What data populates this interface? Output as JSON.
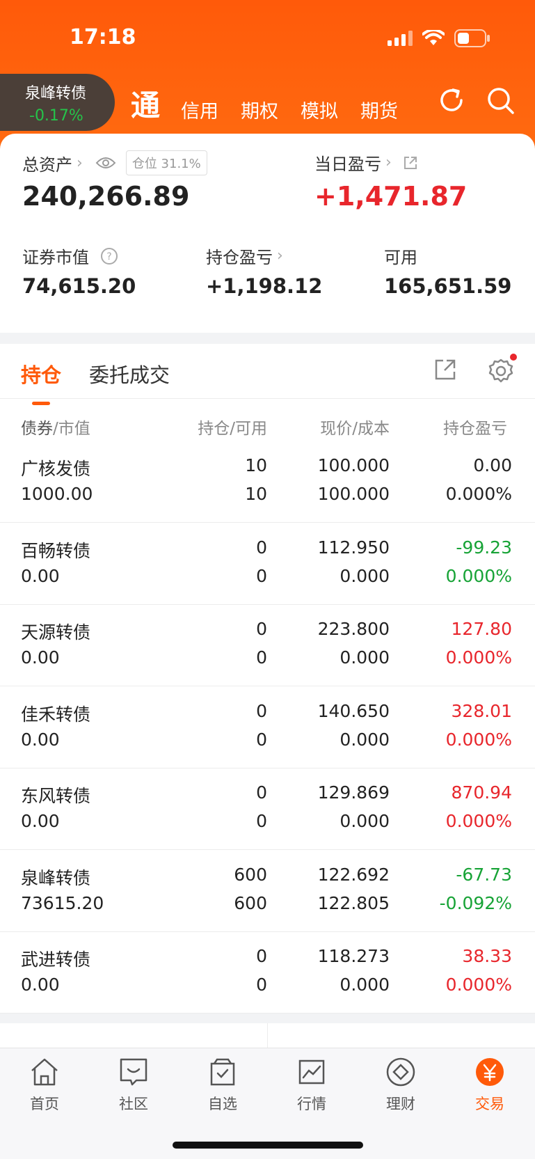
{
  "status_bar": {
    "time": "17:18"
  },
  "floating_ticker": {
    "name": "泉峰转债",
    "change_pct": "-0.17%"
  },
  "nav": {
    "main_tab": "通",
    "tabs": [
      "信用",
      "期权",
      "模拟",
      "期货"
    ],
    "icons": [
      "refresh-icon",
      "search-icon"
    ]
  },
  "summary": {
    "total_assets_label": "总资产",
    "position_ratio": "仓位 31.1%",
    "total_assets_value": "240,266.89",
    "daily_pnl_label": "当日盈亏",
    "daily_pnl_value": "+1,471.87",
    "market_value_label": "证券市值",
    "market_value": "74,615.20",
    "holding_pnl_label": "持仓盈亏",
    "holding_pnl_value": "+1,198.12",
    "available_label": "可用",
    "available_value": "165,651.59"
  },
  "holdings_tabs": {
    "active": "持仓",
    "other": "委托成交"
  },
  "columns": {
    "c1": [
      "债券",
      "市值"
    ],
    "c2": [
      "持仓",
      "可用"
    ],
    "c3": [
      "现价",
      "成本"
    ],
    "c4": "持仓盈亏"
  },
  "rows": [
    {
      "name": "广核发债",
      "market_value": "1000.00",
      "holding": "10",
      "available": "10",
      "price": "100.000",
      "cost": "100.000",
      "pnl": "0.00",
      "pnl_pct": "0.000%",
      "color": "#222222"
    },
    {
      "name": "百畅转债",
      "market_value": "0.00",
      "holding": "0",
      "available": "0",
      "price": "112.950",
      "cost": "0.000",
      "pnl": "-99.23",
      "pnl_pct": "0.000%",
      "color": "#17a336"
    },
    {
      "name": "天源转债",
      "market_value": "0.00",
      "holding": "0",
      "available": "0",
      "price": "223.800",
      "cost": "0.000",
      "pnl": "127.80",
      "pnl_pct": "0.000%",
      "color": "#e8262c"
    },
    {
      "name": "佳禾转债",
      "market_value": "0.00",
      "holding": "0",
      "available": "0",
      "price": "140.650",
      "cost": "0.000",
      "pnl": "328.01",
      "pnl_pct": "0.000%",
      "color": "#e8262c"
    },
    {
      "name": "东风转债",
      "market_value": "0.00",
      "holding": "0",
      "available": "0",
      "price": "129.869",
      "cost": "0.000",
      "pnl": "870.94",
      "pnl_pct": "0.000%",
      "color": "#e8262c"
    },
    {
      "name": "泉峰转债",
      "market_value": "73615.20",
      "holding": "600",
      "available": "600",
      "price": "122.692",
      "cost": "122.805",
      "pnl": "-67.73",
      "pnl_pct": "-0.092%",
      "color": "#17a336"
    },
    {
      "name": "武进转债",
      "market_value": "0.00",
      "holding": "0",
      "available": "0",
      "price": "118.273",
      "cost": "0.000",
      "pnl": "38.33",
      "pnl_pct": "0.000%",
      "color": "#e8262c"
    }
  ],
  "tabbar": [
    {
      "label": "首页",
      "icon": "home-icon"
    },
    {
      "label": "社区",
      "icon": "chat-icon"
    },
    {
      "label": "自选",
      "icon": "watchlist-icon"
    },
    {
      "label": "行情",
      "icon": "chart-icon"
    },
    {
      "label": "理财",
      "icon": "diamond-icon"
    },
    {
      "label": "交易",
      "icon": "yen-icon",
      "active": true
    }
  ],
  "colors": {
    "accent": "#ff5a0a",
    "up": "#e8262c",
    "down": "#17a336"
  }
}
